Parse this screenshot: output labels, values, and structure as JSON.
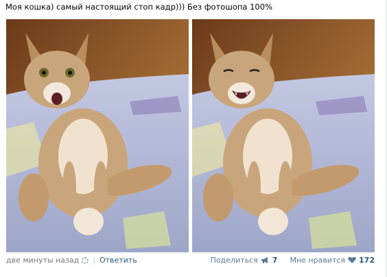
{
  "post": {
    "caption": "Моя кошка) самый настоящий стоп кадр))) Без фотошопа 100%"
  },
  "photos": [
    {
      "name": "cat-eyes-open",
      "icon": "photo-cat-surprised"
    },
    {
      "name": "cat-eyes-closed",
      "icon": "photo-cat-laughing"
    }
  ],
  "footer": {
    "time": "две минуты назад",
    "reply": "Ответить",
    "share_label": "Поделиться",
    "share_count": "7",
    "like_label": "Мне нравится",
    "like_count": "172"
  },
  "colors": {
    "link": "#2b587a",
    "muted": "#777777",
    "share": "#5b7a97"
  }
}
